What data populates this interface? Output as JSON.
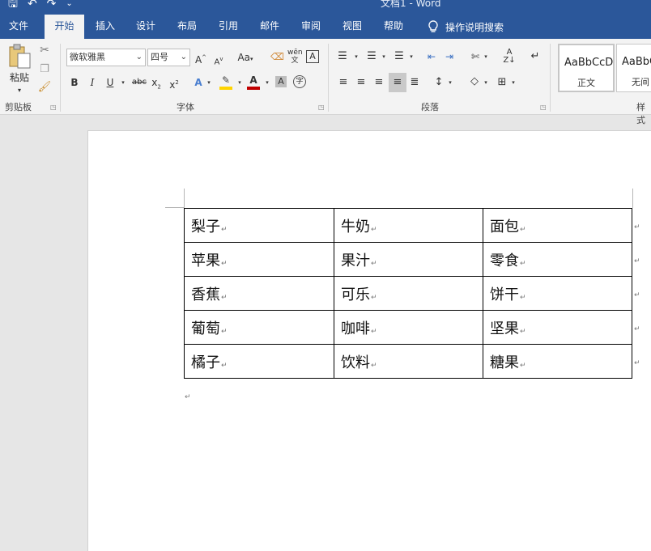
{
  "window": {
    "title": "文档1 - Word"
  },
  "tabs": [
    "文件",
    "开始",
    "插入",
    "设计",
    "布局",
    "引用",
    "邮件",
    "审阅",
    "视图",
    "帮助"
  ],
  "tell_me": "操作说明搜索",
  "clipboard": {
    "paste_label": "粘贴",
    "group_label": "剪贴板"
  },
  "font": {
    "name": "微软雅黑",
    "size": "四号",
    "change_case": "Aa",
    "group_label": "字体"
  },
  "paragraph": {
    "group_label": "段落"
  },
  "styles": {
    "normal_sample": "AaBbCcD",
    "normal_name": "正文",
    "nospacing_sample": "AaBbC",
    "nospacing_name": "无间",
    "group_label": "样式"
  },
  "table": {
    "rows": [
      [
        "梨子",
        "牛奶",
        "面包"
      ],
      [
        "苹果",
        "果汁",
        "零食"
      ],
      [
        "香蕉",
        "可乐",
        "饼干"
      ],
      [
        "葡萄",
        "咖啡",
        "坚果"
      ],
      [
        "橘子",
        "饮料",
        "糖果"
      ]
    ]
  },
  "icons": {
    "save": "save-icon",
    "undo": "undo-icon",
    "redo": "redo-icon",
    "lightbulb": "lightbulb-icon",
    "paste": "clipboard-paste-icon",
    "cut": "scissors-icon",
    "copy": "copy-icon",
    "format_painter": "format-painter-icon"
  },
  "colors": {
    "brand": "#2b579a",
    "ribbon_bg": "#f3f3f3",
    "font_color": "#c00000",
    "highlight": "#ffd400"
  }
}
